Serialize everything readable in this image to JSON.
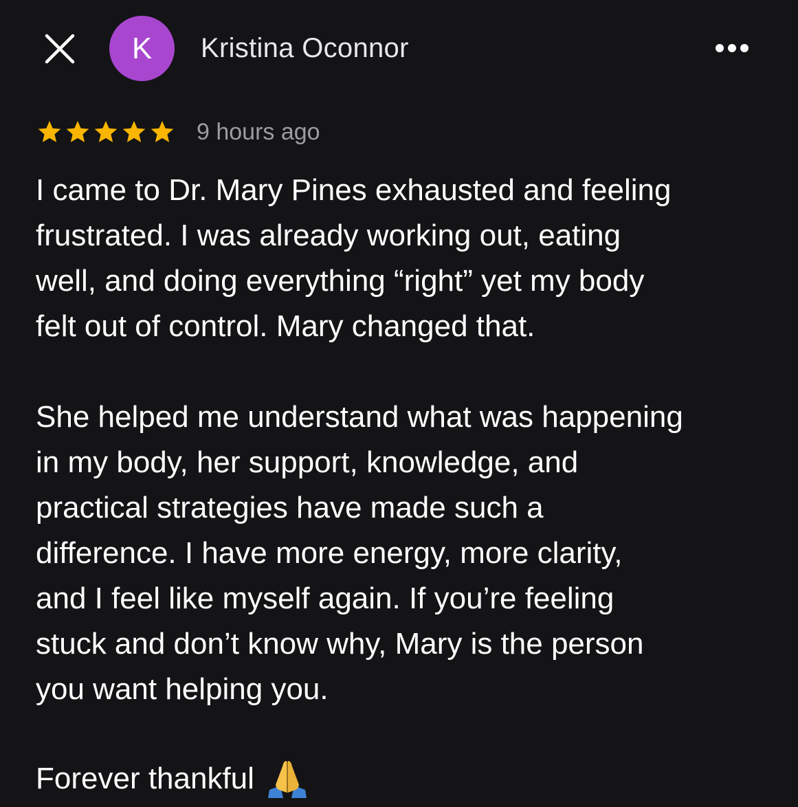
{
  "header": {
    "avatar_letter": "K",
    "avatar_color": "#a846d0",
    "author_name": "Kristina Oconnor",
    "close_icon": "close-icon",
    "more_icon": "more-options-icon"
  },
  "review": {
    "rating": 5,
    "max_rating": 5,
    "star_color": "#f9b500",
    "time_ago": "9 hours ago",
    "paragraphs": [
      "I came to Dr. Mary Pines exhausted and feeling\nfrustrated.  I was already working out, eating\nwell, and doing everything “right” yet my body\nfelt out of control. Mary changed that.",
      "She helped me understand what was happening\nin my body, her support, knowledge, and\npractical strategies have made such a\ndifference.  I have more energy, more clarity,\nand I feel like myself again.  If you’re feeling\nstuck and don’t know why, Mary is the person\nyou want helping you."
    ],
    "closing": "Forever thankful",
    "closing_emoji_icon": "folded-hands-icon"
  }
}
